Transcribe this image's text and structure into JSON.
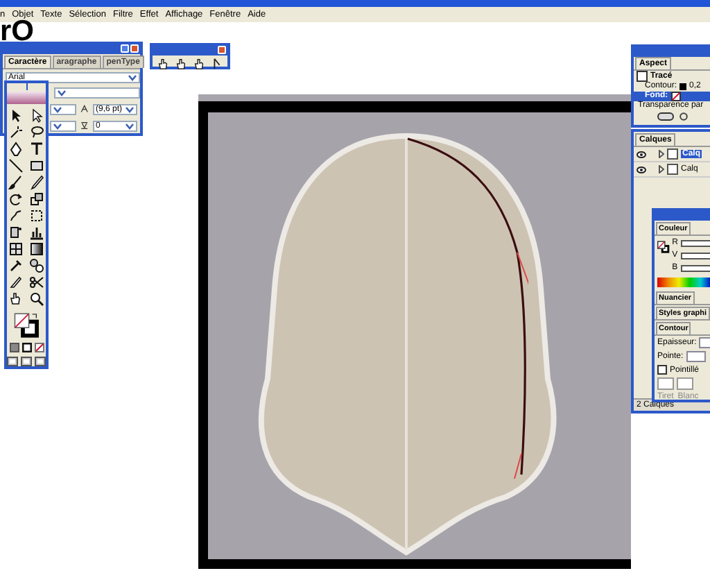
{
  "menu_bar": {
    "items": [
      "n",
      "Objet",
      "Texte",
      "Sélection",
      "Filtre",
      "Effet",
      "Affichage",
      "Fenêtre",
      "Aide"
    ]
  },
  "document_text": "rO",
  "character_palette": {
    "tabs": [
      {
        "label": "Caractère",
        "selected": true
      },
      {
        "label": "aragraphe",
        "selected": false
      },
      {
        "label": "penType",
        "selected": false
      }
    ],
    "font": "Arial",
    "leading": "(9,6 pt)",
    "tracking": "0"
  },
  "aspect_palette": {
    "tab": "Aspect",
    "title_row": "Tracé",
    "rows": [
      {
        "label": "Contour:",
        "value": "0,2",
        "selected": false
      },
      {
        "label": "Fond:",
        "value": "",
        "selected": true
      }
    ],
    "transparency": "Transparence par"
  },
  "layers_palette": {
    "tab": "Calques",
    "layers": [
      {
        "name": "Calq",
        "selected": true
      },
      {
        "name": "Calq",
        "selected": false
      }
    ],
    "footer": "2 Calques"
  },
  "color_palette": {
    "tab": "Couleur",
    "channels": [
      "R",
      "V",
      "B"
    ]
  },
  "swatches_tab": "Nuancier",
  "styles_tab": "Styles graphi",
  "stroke_palette": {
    "tab": "Contour",
    "weight_label": "Epaisseur:",
    "cap_label": "Pointe:",
    "dashed": {
      "label": "Pointillé",
      "checked": false
    },
    "dash_labels": [
      "Tiret",
      "Blanc"
    ]
  }
}
